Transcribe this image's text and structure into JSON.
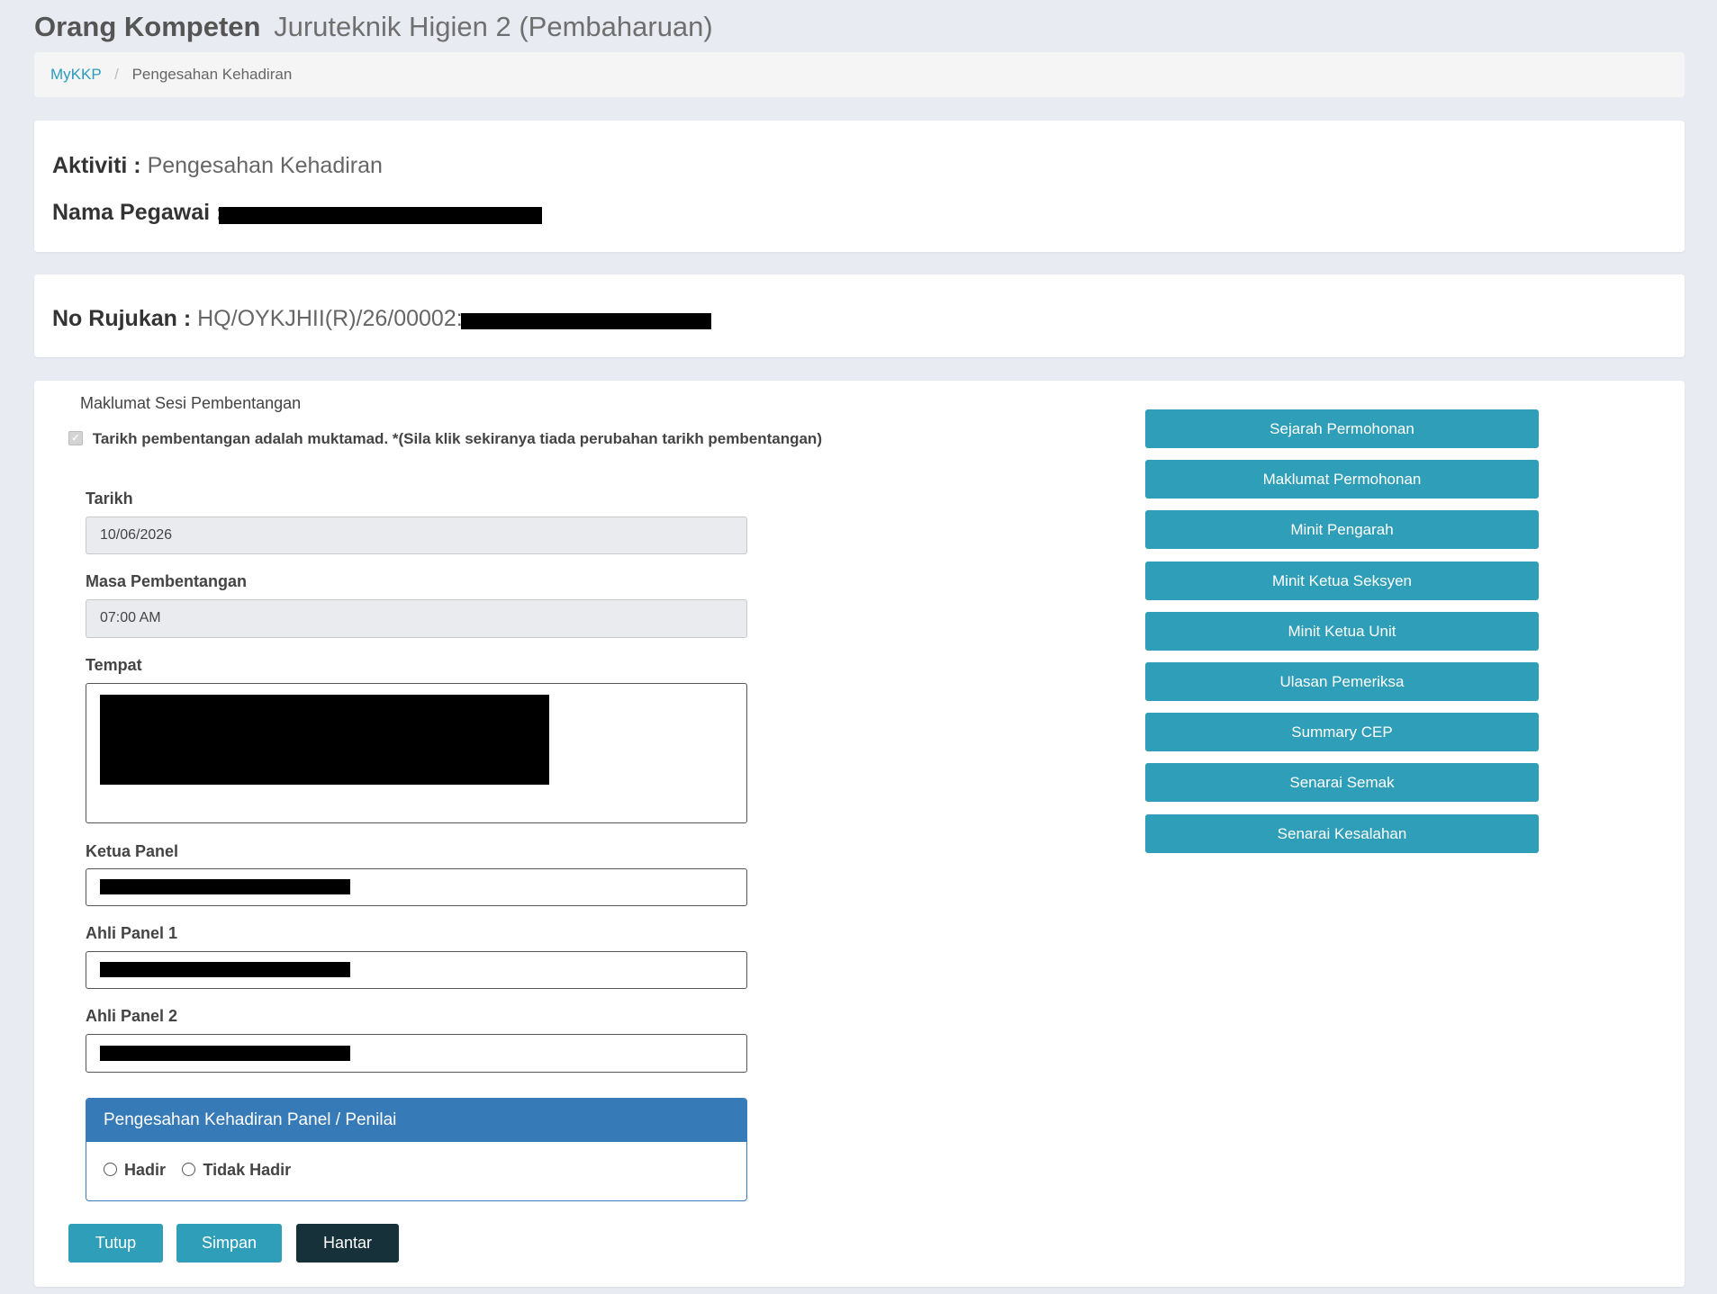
{
  "header": {
    "title_main": "Orang Kompeten",
    "title_sub": "Juruteknik Higien 2 (Pembaharuan)"
  },
  "breadcrumb": {
    "home": "MyKKP",
    "separator": "/",
    "current": "Pengesahan Kehadiran"
  },
  "activity": {
    "aktiviti_label": "Aktiviti :",
    "aktiviti_value": "Pengesahan Kehadiran",
    "nama_label": "Nama Pegawai :"
  },
  "reference": {
    "label": "No Rujukan :",
    "value": "HQ/OYKJHII(R)/26/00002:"
  },
  "session": {
    "title": "Maklumat Sesi Pembentangan",
    "checkbox_label": "Tarikh pembentangan adalah muktamad. *(Sila klik sekiranya tiada perubahan tarikh pembentangan)",
    "checkbox_checked": true,
    "tarikh_label": "Tarikh",
    "tarikh_value": "10/06/2026",
    "masa_label": "Masa Pembentangan",
    "masa_value": "07:00 AM",
    "tempat_label": "Tempat",
    "ketua_label": "Ketua Panel",
    "ahli1_label": "Ahli Panel 1",
    "ahli2_label": "Ahli Panel 2"
  },
  "attendance": {
    "heading": "Pengesahan Kehadiran Panel / Penilai",
    "option_present": "Hadir",
    "option_absent": "Tidak Hadir"
  },
  "side_buttons": [
    "Sejarah Permohonan",
    "Maklumat Permohonan",
    "Minit Pengarah",
    "Minit Ketua Seksyen",
    "Minit Ketua Unit",
    "Ulasan Pemeriksa",
    "Summary CEP",
    "Senarai Semak",
    "Senarai Kesalahan"
  ],
  "actions": {
    "close": "Tutup",
    "save": "Simpan",
    "submit": "Hantar"
  },
  "colors": {
    "accent_teal": "#2f9eb8",
    "panel_blue": "#377ab8",
    "dark_button": "#17313a",
    "background": "#e9ebf3"
  }
}
